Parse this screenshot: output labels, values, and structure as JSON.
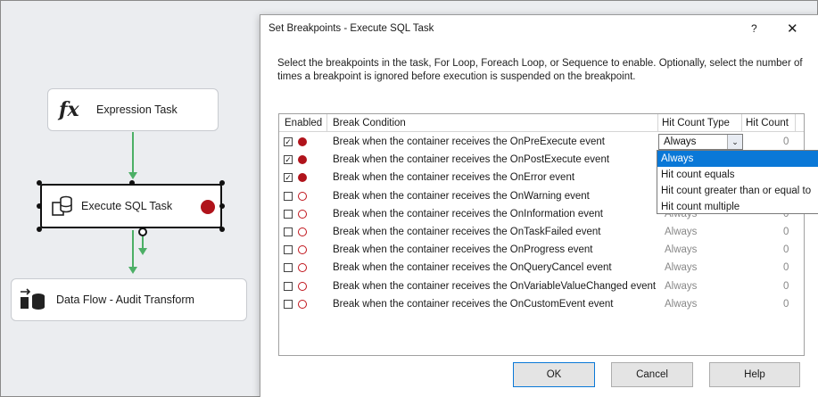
{
  "designer": {
    "expression_task": {
      "icon": "fx",
      "label": "Expression Task"
    },
    "execute_sql_task": {
      "label": "Execute SQL Task"
    },
    "data_flow_task": {
      "label": "Data Flow - Audit Transform"
    }
  },
  "dialog": {
    "title": "Set Breakpoints - Execute SQL Task",
    "help_glyph": "?",
    "close_glyph": "✕",
    "description": "Select the breakpoints in the task, For Loop, Foreach Loop, or Sequence to enable. Optionally, select the number of times a breakpoint is ignored before execution is suspended on the breakpoint.",
    "columns": {
      "enabled": "Enabled",
      "break_condition": "Break Condition",
      "hit_count_type": "Hit Count Type",
      "hit_count": "Hit Count"
    },
    "rows": [
      {
        "enabled": true,
        "condition": "Break when the container receives the OnPreExecute event",
        "hit_count_type": "Always",
        "hit_count": "0"
      },
      {
        "enabled": true,
        "condition": "Break when the container receives the OnPostExecute event",
        "hit_count_type": "Always",
        "hit_count": "0"
      },
      {
        "enabled": true,
        "condition": "Break when the container receives the OnError event",
        "hit_count_type": "Always",
        "hit_count": "0"
      },
      {
        "enabled": false,
        "condition": "Break when the container receives the OnWarning event",
        "hit_count_type": "Always",
        "hit_count": "0"
      },
      {
        "enabled": false,
        "condition": "Break when the container receives the OnInformation event",
        "hit_count_type": "Always",
        "hit_count": "0"
      },
      {
        "enabled": false,
        "condition": "Break when the container receives the OnTaskFailed event",
        "hit_count_type": "Always",
        "hit_count": "0"
      },
      {
        "enabled": false,
        "condition": "Break when the container receives the OnProgress event",
        "hit_count_type": "Always",
        "hit_count": "0"
      },
      {
        "enabled": false,
        "condition": "Break when the container receives the OnQueryCancel event",
        "hit_count_type": "Always",
        "hit_count": "0"
      },
      {
        "enabled": false,
        "condition": "Break when the container receives the OnVariableValueChanged event",
        "hit_count_type": "Always",
        "hit_count": "0"
      },
      {
        "enabled": false,
        "condition": "Break when the container receives the OnCustomEvent event",
        "hit_count_type": "Always",
        "hit_count": "0"
      }
    ],
    "combo_value": "Always",
    "dropdown_options": [
      "Always",
      "Hit count equals",
      "Hit count greater than or equal to",
      "Hit count multiple"
    ],
    "dropdown_selected": "Always",
    "buttons": {
      "ok": "OK",
      "cancel": "Cancel",
      "help": "Help"
    }
  },
  "colors": {
    "breakpoint": "#b0131b",
    "connector": "#4caf66",
    "selection": "#0a78d7"
  }
}
